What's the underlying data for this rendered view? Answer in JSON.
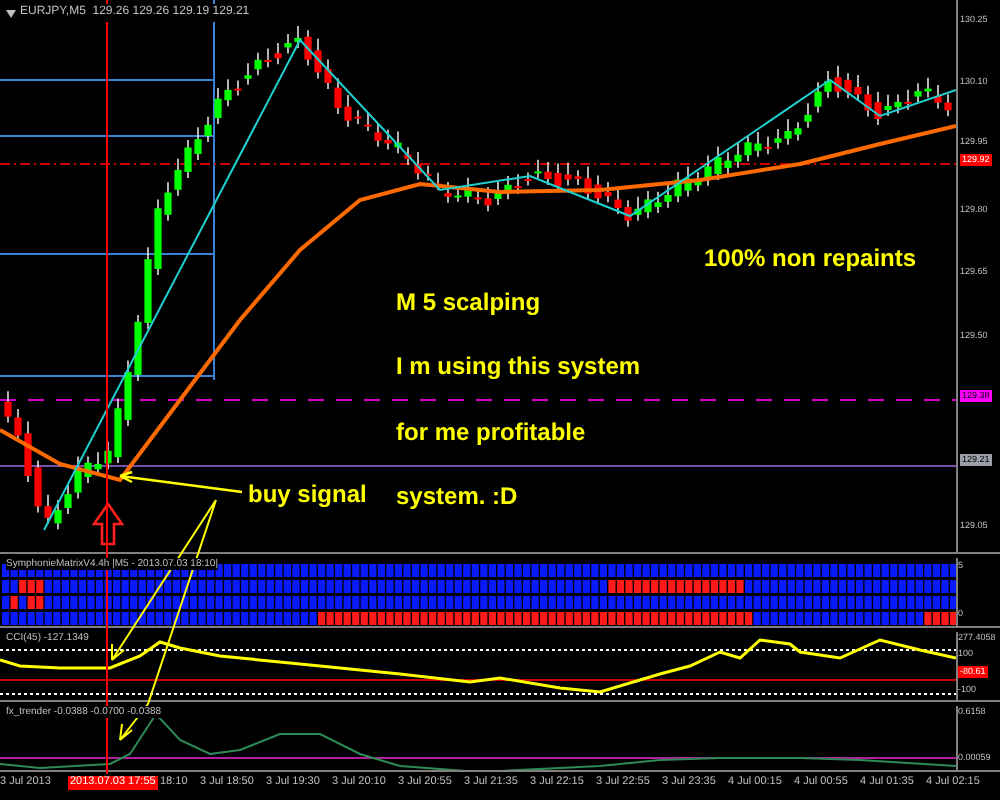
{
  "chart": {
    "title": "EURJPY,M5  129.26 129.26 129.19 129.21",
    "price_labels": [
      {
        "text": "130.25",
        "kind": "tick"
      },
      {
        "text": "130.10",
        "kind": "tick"
      },
      {
        "text": "129.95",
        "kind": "tick"
      },
      {
        "text": "129.92",
        "kind": "bid"
      },
      {
        "text": "129.80",
        "kind": "tick"
      },
      {
        "text": "129.65",
        "kind": "tick"
      },
      {
        "text": "129.50",
        "kind": "tick"
      },
      {
        "text": "129.38",
        "kind": "level"
      },
      {
        "text": "129.21",
        "kind": "last"
      },
      {
        "text": "129.05",
        "kind": "tick"
      }
    ],
    "annotations": [
      "100% non repaints",
      "M 5 scalping",
      "I m using this system",
      "for me profitable",
      "system. :D",
      "buy signal"
    ]
  },
  "panes": [
    {
      "kind": "matrix",
      "label": "SymphonieMatrixV4.4h |M5 - 2013.07.03 18:10|",
      "axis": [
        {
          "text": "5",
          "kind": "tick"
        },
        {
          "text": "0",
          "kind": "tick"
        }
      ]
    },
    {
      "kind": "cci",
      "label": "CCI(45) -127.1349",
      "axis": [
        {
          "text": "277.4058",
          "kind": "tick"
        },
        {
          "text": "100",
          "kind": "tick"
        },
        {
          "text": "-80.61",
          "kind": "bid"
        },
        {
          "text": "-100",
          "kind": "tick"
        }
      ]
    },
    {
      "kind": "trender",
      "label": "fx_trender -0.0388 -0.0700 -0.0388",
      "axis": [
        {
          "text": "0.6158",
          "kind": "tick"
        },
        {
          "text": "0.00059",
          "kind": "tick"
        }
      ]
    }
  ],
  "time_axis": [
    {
      "text": "3 Jul 2013",
      "kind": "tick"
    },
    {
      "text": "2013.07.03 17:55",
      "kind": "highlight"
    },
    {
      "text": "18:10",
      "kind": "tick"
    },
    {
      "text": "3 Jul 18:50",
      "kind": "tick"
    },
    {
      "text": "3 Jul 19:30",
      "kind": "tick"
    },
    {
      "text": "3 Jul 20:10",
      "kind": "tick"
    },
    {
      "text": "3 Jul 20:55",
      "kind": "tick"
    },
    {
      "text": "3 Jul 21:35",
      "kind": "tick"
    },
    {
      "text": "3 Jul 22:15",
      "kind": "tick"
    },
    {
      "text": "3 Jul 22:55",
      "kind": "tick"
    },
    {
      "text": "3 Jul 23:35",
      "kind": "tick"
    },
    {
      "text": "4 Jul 00:15",
      "kind": "tick"
    },
    {
      "text": "4 Jul 00:55",
      "kind": "tick"
    },
    {
      "text": "4 Jul 01:35",
      "kind": "tick"
    },
    {
      "text": "4 Jul 02:15",
      "kind": "tick"
    }
  ]
}
